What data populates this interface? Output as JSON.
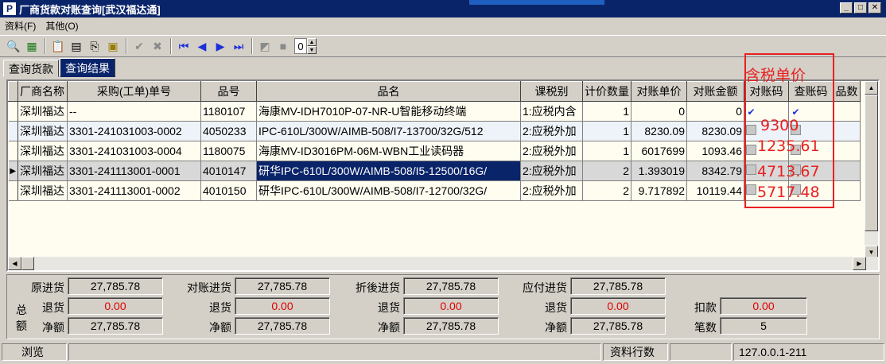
{
  "window": {
    "title": "厂商货款对账查询[武汉福达通]",
    "app_icon": "P",
    "buttons": [
      "_",
      "□",
      "✕"
    ]
  },
  "menu": [
    "资料(F)",
    "其他(O)"
  ],
  "toolbar": {
    "spin_value": "0"
  },
  "tabs": [
    "查询货款",
    "查询结果"
  ],
  "grid": {
    "columns": [
      "厂商名称",
      "采购(工单)单号",
      "品号",
      "品名",
      "课税别",
      "计价数量",
      "对账单价",
      "对账金额",
      "对账码",
      "查账码",
      "品数"
    ],
    "rows": [
      {
        "vendor": "深圳福达",
        "order": "--",
        "code": "1180107",
        "name": "海康MV-IDH7010P-07-NR-U智能移动终端",
        "tax": "1:应税内含",
        "qty": "1",
        "price": "0",
        "amount": "0",
        "check1": "checked",
        "check2": "checked"
      },
      {
        "vendor": "深圳福达",
        "order": "3301-241031003-0002",
        "code": "4050233",
        "name": "IPC-610L/300W/AIMB-508/I7-13700/32G/512",
        "tax": "2:应税外加",
        "qty": "1",
        "price": "8230.09",
        "amount": "8230.09",
        "check1": "unchecked",
        "check2": "unchecked"
      },
      {
        "vendor": "深圳福达",
        "order": "3301-241031003-0004",
        "code": "1180075",
        "name": "海康MV-ID3016PM-06M-WBN工业读码器",
        "tax": "2:应税外加",
        "qty": "1",
        "price": "6017699",
        "amount": "1093.46",
        "check1": "unchecked",
        "check2": "unchecked"
      },
      {
        "vendor": "深圳福达",
        "order": "3301-241113001-0001",
        "code": "4010147",
        "name": "研华IPC-610L/300W/AIMB-508/I5-12500/16G/",
        "tax": "2:应税外加",
        "qty": "2",
        "price": "1.393019",
        "amount": "8342.79",
        "check1": "unchecked",
        "check2": "unchecked"
      },
      {
        "vendor": "深圳福达",
        "order": "3301-241113001-0002",
        "code": "4010150",
        "name": "研华IPC-610L/300W/AIMB-508/I7-12700/32G/",
        "tax": "2:应税外加",
        "qty": "2",
        "price": "9.717892",
        "amount": "10119.44",
        "check1": "unchecked",
        "check2": "unchecked"
      }
    ],
    "current_row": 3
  },
  "annotation": {
    "heading": "含税单价",
    "values": [
      "9300",
      "1235.61",
      "4713.67",
      "5717.48"
    ],
    "color": "#e82020"
  },
  "summary": {
    "side_label": [
      "总",
      "额"
    ],
    "groups": [
      {
        "top_label": "原进货",
        "top": "27,785.78",
        "return_label": "退货",
        "return": "0.00",
        "net_label": "净额",
        "net": "27,785.78"
      },
      {
        "top_label": "对账进货",
        "top": "27,785.78",
        "return_label": "退货",
        "return": "0.00",
        "net_label": "净额",
        "net": "27,785.78"
      },
      {
        "top_label": "折後进货",
        "top": "27,785.78",
        "return_label": "退货",
        "return": "0.00",
        "net_label": "净额",
        "net": "27,785.78"
      },
      {
        "top_label": "应付进货",
        "top": "27,785.78",
        "return_label": "退货",
        "return": "0.00",
        "net_label": "净额",
        "net": "27,785.78"
      }
    ],
    "deduct_label": "扣款",
    "deduct": "0.00",
    "count_label": "笔数",
    "count": "5"
  },
  "status": {
    "mode": "浏览",
    "rows_label": "资料行数",
    "host": "127.0.0.1-211"
  }
}
